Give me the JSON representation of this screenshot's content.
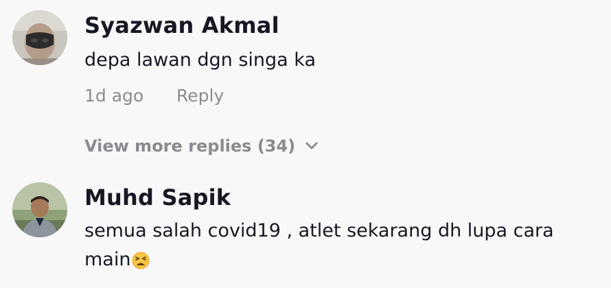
{
  "comments": [
    {
      "author": "Syazwan Akmal",
      "text": "depa lawan dgn singa ka",
      "time": "1d ago",
      "reply_label": "Reply",
      "avatar_icon": "user-avatar-masked"
    },
    {
      "author": "Muhd Sapik",
      "text": "semua salah covid19 , atlet sekarang dh lupa cara",
      "text_line2": "main",
      "emoji_icon": "tired-face-emoji",
      "avatar_icon": "user-avatar-photo"
    }
  ],
  "view_more": {
    "label": "View more replies (34)",
    "icon": "chevron-down-icon"
  },
  "colors": {
    "background": "#f8f8f8",
    "text": "#161823",
    "muted": "#8a8b91"
  }
}
